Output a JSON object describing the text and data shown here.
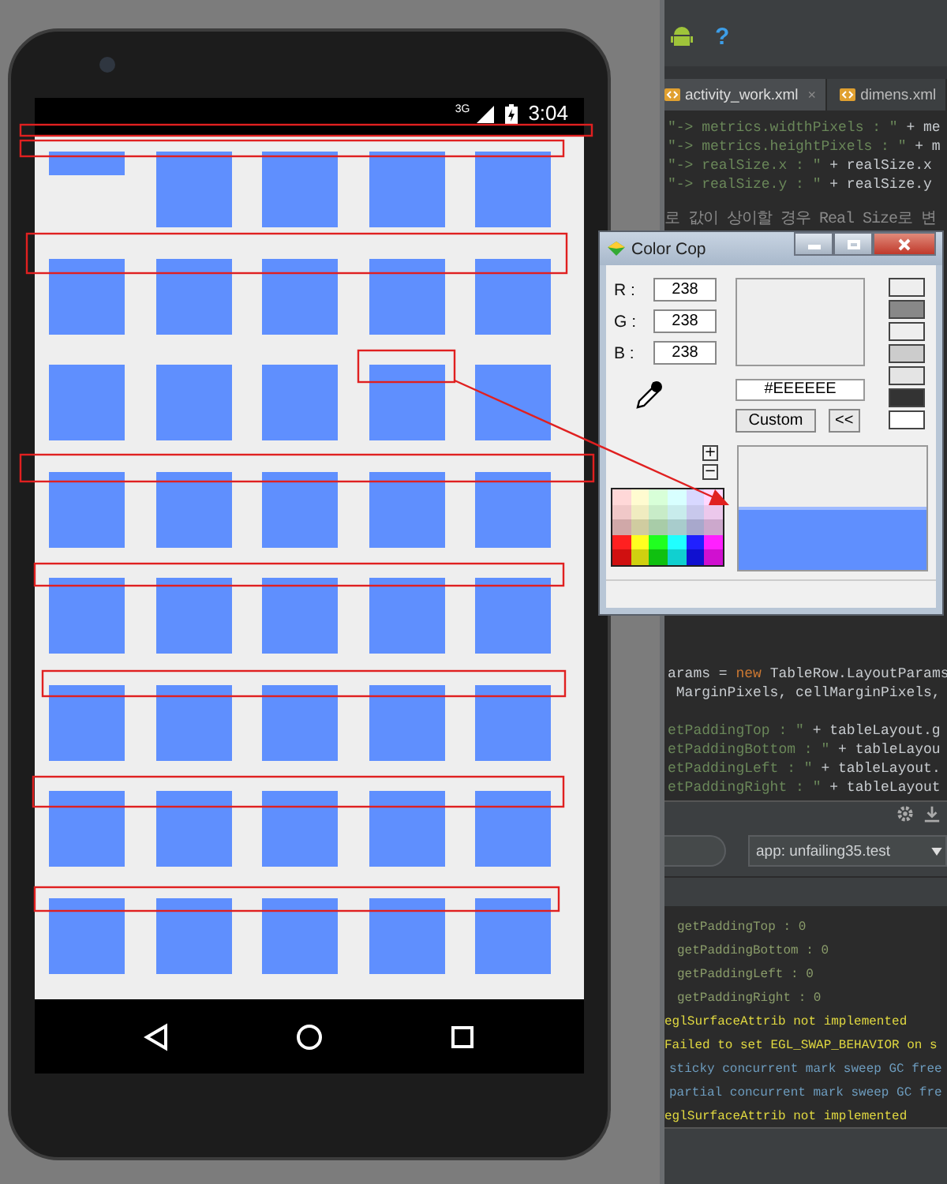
{
  "phone": {
    "status_bar": {
      "network": "3G",
      "time": "3:04"
    }
  },
  "ide": {
    "toolbar": {
      "help": "?"
    },
    "tabs": [
      {
        "label": "activity_work.xml",
        "close": "×",
        "selected": true
      },
      {
        "label": "dimens.xml",
        "selected": false
      }
    ],
    "code_top": [
      [
        {
          "kind": "string",
          "text": "\"-> metrics.widthPixels : \""
        },
        {
          "kind": "plain",
          "text": " + me"
        }
      ],
      [
        {
          "kind": "string",
          "text": "\"-> metrics.heightPixels : \""
        },
        {
          "kind": "plain",
          "text": " + m"
        }
      ],
      [
        {
          "kind": "string",
          "text": "\"-> realSize.x : \""
        },
        {
          "kind": "plain",
          "text": " + realSize.x"
        }
      ],
      [
        {
          "kind": "string",
          "text": "\"-> realSize.y : \""
        },
        {
          "kind": "plain",
          "text": " + realSize.y"
        }
      ]
    ],
    "comment": "로 값이 상이할 경우 Real Size로 변",
    "code_middle": [
      [
        {
          "kind": "plain",
          "text": "arams = "
        },
        {
          "kind": "keyword",
          "text": "new"
        },
        {
          "kind": "plain",
          "text": " TableRow.LayoutParams"
        }
      ],
      [
        {
          "kind": "plain",
          "text": " MarginPixels, cellMarginPixels,"
        }
      ]
    ],
    "code_bottom": [
      [
        {
          "kind": "string",
          "text": "etPaddingTop : \""
        },
        {
          "kind": "plain",
          "text": " + tableLayout.g"
        }
      ],
      [
        {
          "kind": "string",
          "text": "etPaddingBottom : \""
        },
        {
          "kind": "plain",
          "text": " + tableLayou"
        }
      ],
      [
        {
          "kind": "string",
          "text": "etPaddingLeft : \""
        },
        {
          "kind": "plain",
          "text": " + tableLayout."
        }
      ],
      [
        {
          "kind": "string",
          "text": "etPaddingRight : \""
        },
        {
          "kind": "plain",
          "text": " + tableLayout"
        }
      ]
    ],
    "process": "app: unfailing35.test",
    "console": [
      {
        "kind": "verbose",
        "text": "getPaddingTop : 0"
      },
      {
        "kind": "verbose",
        "text": "getPaddingBottom : 0"
      },
      {
        "kind": "verbose",
        "text": "getPaddingLeft : 0"
      },
      {
        "kind": "verbose",
        "text": "getPaddingRight : 0"
      },
      {
        "kind": "warn",
        "text": "eglSurfaceAttrib not implemented"
      },
      {
        "kind": "warn",
        "text": "Failed to set EGL_SWAP_BEHAVIOR on s"
      },
      {
        "kind": "debug",
        "text": "sticky concurrent mark sweep GC free"
      },
      {
        "kind": "debug",
        "text": "partial concurrent mark sweep GC fre"
      },
      {
        "kind": "warn",
        "text": "eglSurfaceAttrib not implemented"
      }
    ]
  },
  "color_cop": {
    "title": "Color Cop",
    "channels": [
      {
        "label": "R :",
        "value": "238"
      },
      {
        "label": "G :",
        "value": "238"
      },
      {
        "label": "B :",
        "value": "238"
      }
    ],
    "hex": "#EEEEEE",
    "buttons": [
      "Custom",
      "<<"
    ],
    "zoom_buttons": [
      "+",
      "−"
    ],
    "history": [
      {
        "color": "#eeeeee"
      },
      {
        "color": "#888888"
      },
      {
        "color": "#eeeeee"
      },
      {
        "color": "#cccccc"
      },
      {
        "color": "#e4e4e4"
      },
      {
        "color": "#333333"
      },
      {
        "color": "#ffffff"
      }
    ]
  }
}
